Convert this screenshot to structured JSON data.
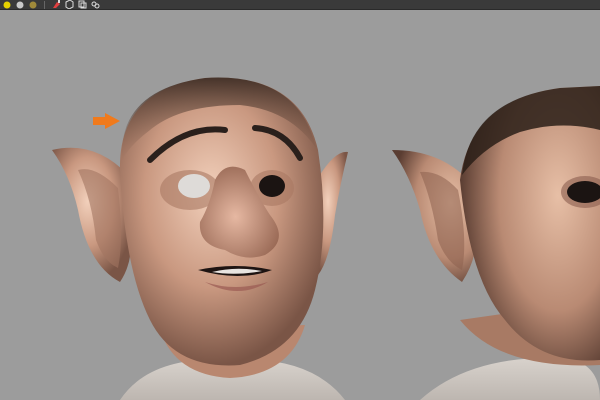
{
  "toolbar": {
    "buttons": [
      {
        "name": "shading-sphere-yellow",
        "color": "#e6d200"
      },
      {
        "name": "shading-sphere-gray",
        "color": "#bdbdbd"
      },
      {
        "name": "shading-sphere-dark",
        "color": "#8a7a40"
      }
    ],
    "tools": [
      "paint-icon",
      "cube-icon",
      "copy-icon",
      "link-icon"
    ]
  },
  "viewport": {
    "background_color": "#9c9c9c",
    "skin_color": "#c99880",
    "pointer_color": "#f07a1c"
  }
}
